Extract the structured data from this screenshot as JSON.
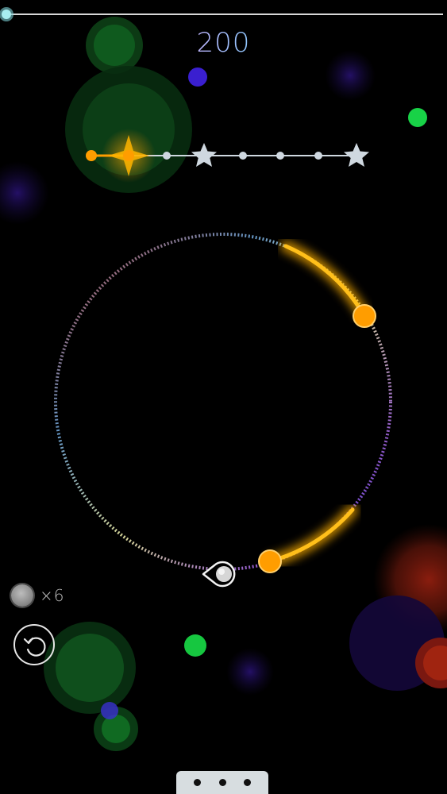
{
  "game": {
    "score": "200",
    "lives_count": "×6"
  },
  "level_track": {
    "stops": [
      "dot",
      "dot",
      "dot",
      "star",
      "dot",
      "dot",
      "dot",
      "star"
    ],
    "current_index": 1
  },
  "icons": {
    "restart": "restart-icon",
    "lives": "ball-icon",
    "menu": "more-dots-icon"
  },
  "colors": {
    "accent": "#ff9d00",
    "track": "#cfd8e0",
    "star": "#cfd8e0"
  }
}
